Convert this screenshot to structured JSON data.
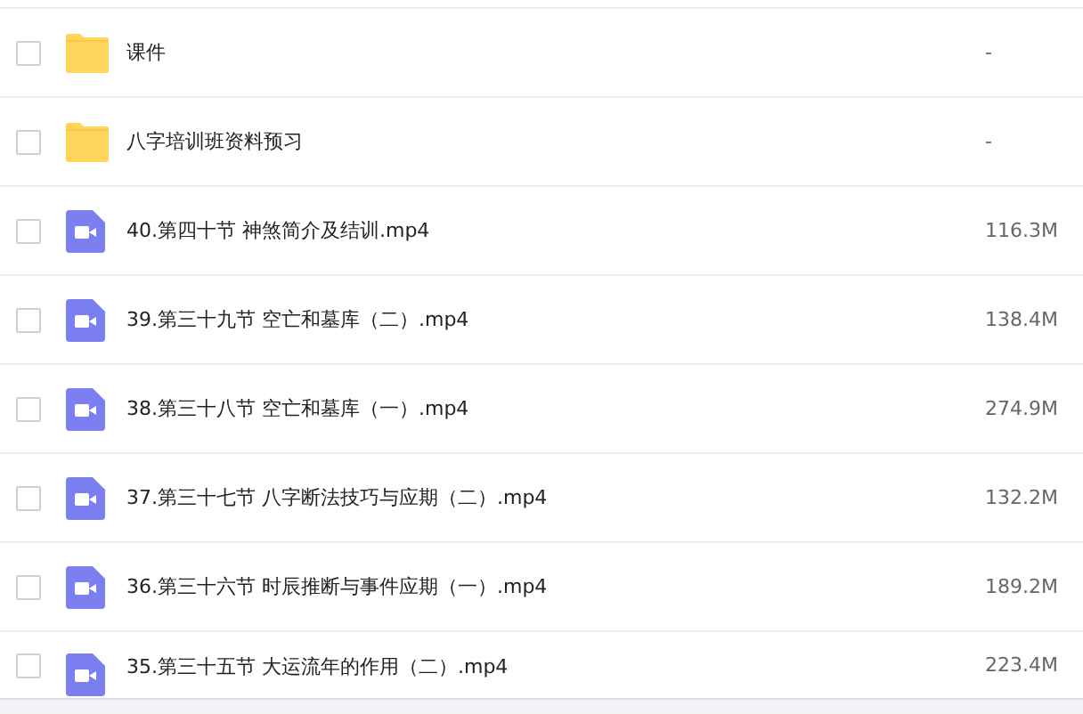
{
  "files": [
    {
      "kind": "folder",
      "name": "课件",
      "size": "-",
      "checked": false
    },
    {
      "kind": "folder",
      "name": "八字培训班资料预习",
      "size": "-",
      "checked": false
    },
    {
      "kind": "video",
      "name": "40.第四十节 神煞简介及结训.mp4",
      "size": "116.3M",
      "checked": false
    },
    {
      "kind": "video",
      "name": "39.第三十九节 空亡和墓库（二）.mp4",
      "size": "138.4M",
      "checked": false
    },
    {
      "kind": "video",
      "name": "38.第三十八节 空亡和墓库（一）.mp4",
      "size": "274.9M",
      "checked": false
    },
    {
      "kind": "video",
      "name": "37.第三十七节 八字断法技巧与应期（二）.mp4",
      "size": "132.2M",
      "checked": false
    },
    {
      "kind": "video",
      "name": "36.第三十六节 时辰推断与事件应期（一）.mp4",
      "size": "189.2M",
      "checked": false
    },
    {
      "kind": "video",
      "name": "35.第三十五节 大运流年的作用（二）.mp4",
      "size": "223.4M",
      "checked": false
    }
  ]
}
